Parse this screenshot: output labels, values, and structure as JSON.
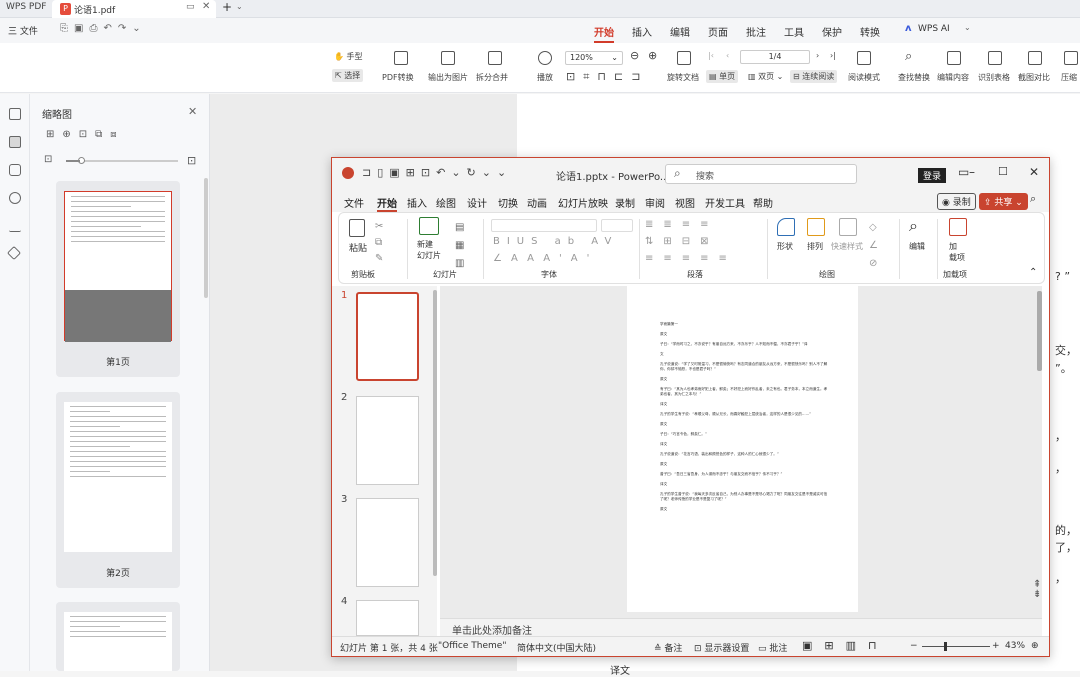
{
  "app": {
    "brand": "WPS PDF",
    "tab_title": "论语1.pdf"
  },
  "menubar": {
    "file": "三 文件",
    "tabs": [
      "开始",
      "插入",
      "编辑",
      "页面",
      "批注",
      "工具",
      "保护",
      "转换"
    ],
    "ai_label": "WPS AI"
  },
  "ribbon": {
    "hand": "手型",
    "select": "选择",
    "pdf_convert": "PDF转换",
    "export_image": "输出为图片",
    "split_merge": "拆分合并",
    "play": "播放",
    "zoom": "120%",
    "page_value": "1/4",
    "rotate": "旋转文档",
    "single": "单页",
    "double": "双页",
    "continuous": "连续阅读",
    "read_mode": "阅读模式",
    "find_replace": "查找替换",
    "edit_content": "编辑内容",
    "recognize_table": "识别表格",
    "screenshot_compare": "截图对比",
    "compress": "压缩"
  },
  "thumbs": {
    "title": "缩略图",
    "page1": "第1页",
    "page2": "第2页"
  },
  "pdf_text": {
    "frag1": "? ”",
    "frag2": "交，",
    "frag3": "”。",
    "frag4": "，",
    "frag5": "，",
    "frag6": "的，",
    "frag7": "了，",
    "frag8": "，",
    "frag9": "译文"
  },
  "ppt": {
    "filename": "论语1.pptx - PowerPo...",
    "search_placeholder": "搜索",
    "login": "登录",
    "menu": [
      "文件",
      "开始",
      "插入",
      "绘图",
      "设计",
      "切换",
      "动画",
      "幻灯片放映",
      "录制",
      "审阅",
      "视图",
      "开发工具",
      "帮助"
    ],
    "record": "录制",
    "share": "共享",
    "groups": {
      "clipboard": "剪贴板",
      "paste": "粘贴",
      "slides": "幻灯片",
      "new_slide": "新建\n幻灯片",
      "font": "字体",
      "paragraph": "段落",
      "drawing": "绘图",
      "shape": "形状",
      "arrange": "排列",
      "quick_style": "快速样式",
      "editing": "编辑",
      "addin": "加载项",
      "add": "加\n载项"
    },
    "slide_numbers": [
      "1",
      "2",
      "3",
      "4"
    ],
    "notes": "单击此处添加备注",
    "status": {
      "slide": "幻灯片 第 1 张，共 4 张",
      "theme": "\"Office Theme\"",
      "lang": "简体中文(中国大陆)",
      "notes_btn": "备注",
      "display": "显示器设置",
      "comments": "批注",
      "zoom": "43%"
    },
    "slide_text": [
      "学而篇第一",
      "原文",
      "子曰：“学而时习之，不亦说乎？有朋自远方来，不亦乐乎？人不知而不愠，不亦君子乎？”译",
      "文",
      "孔子说道说：“学了又时常温习，不是很愉快吗？有志同道合的朋友从远方来，不是很快乐吗？别人不了解你，你却不恼怒，不也是君子吗？”",
      "原文",
      "有子曰：“其为人也孝弟而好犯上者，鲜矣；不好犯上而好作乱者，未之有也。君子务本，本立而道生。孝弟也者，其为仁之本与！”",
      "译文",
      "孔子的学生有子说：“孝顺父母，顺从兄长，而喜好触犯上层统治者，这样的人是很少见的……”",
      "原文",
      "子曰：“巧言令色，鲜矣仁。”",
      "译文",
      "孔子说道说：“花言巧语，装出和颜悦色的样子，这种人的仁心就很少了。”",
      "原文",
      "曾子曰：“吾日三省吾身，为人谋而不忠乎？与朋友交而不信乎？传不习乎？”",
      "译文",
      "孔子的学生曾子说：“我每天多次反省自己，为别人办事是不是尽心竭力了呢？同朋友交往是不是诚实可信了呢？老师传授的学业是不是复习了呢？”",
      "原文"
    ]
  }
}
